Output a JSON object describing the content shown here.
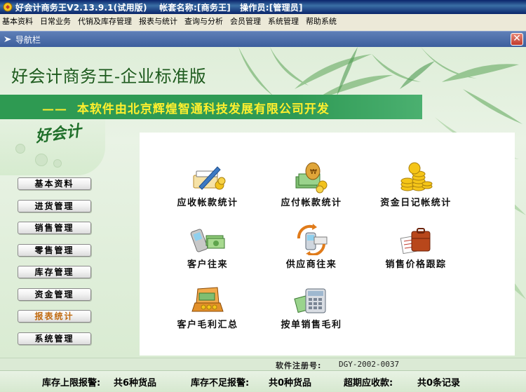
{
  "window": {
    "title": "好会计商务王V2.13.9.1(试用版)    帐套名称:[商务王]   操作员:[管理员]"
  },
  "menu": [
    "基本资料",
    "日常业务",
    "代销及库存管理",
    "报表与统计",
    "查询与分析",
    "会员管理",
    "系统管理",
    "帮助系统"
  ],
  "nav_panel": {
    "title": "导航栏",
    "close_symbol": "✕"
  },
  "banner": {
    "product_name": "好会计商务王-企业标准版",
    "tagline": "——  本软件由北京辉煌智通科技发展有限公司开发",
    "logo": "好会计"
  },
  "sidebar": {
    "items": [
      {
        "label": "基本资料"
      },
      {
        "label": "进货管理"
      },
      {
        "label": "销售管理"
      },
      {
        "label": "零售管理"
      },
      {
        "label": "库存管理"
      },
      {
        "label": "资金管理"
      },
      {
        "label": "报表统计"
      },
      {
        "label": "系统管理"
      }
    ],
    "active_index": 6
  },
  "modules": [
    {
      "label": "应收帐款统计",
      "icon": "receivable-icon"
    },
    {
      "label": "应付帐款统计",
      "icon": "payable-icon"
    },
    {
      "label": "资金日记帐统计",
      "icon": "coins-icon"
    },
    {
      "label": "客户往来",
      "icon": "customer-icon"
    },
    {
      "label": "供应商往来",
      "icon": "supplier-icon"
    },
    {
      "label": "销售价格跟踪",
      "icon": "briefcase-icon"
    },
    {
      "label": "客户毛利汇总",
      "icon": "cashbox-icon"
    },
    {
      "label": "按单销售毛利",
      "icon": "calculator-icon"
    }
  ],
  "registration": {
    "label": "软件注册号:",
    "value": "DGY-2002-0037"
  },
  "status": {
    "upper_alert_label": "库存上限报警:",
    "upper_alert_value": "共6种货品",
    "lower_alert_label": "库存不足报警:",
    "lower_alert_value": "共0种货品",
    "overdue_label": "超期应收款:",
    "overdue_value": "共0条记录"
  },
  "colors": {
    "accent_green": "#2f9a55",
    "tagline_yellow": "#ffef2e",
    "active_sidebar": "#c06a10",
    "title_blue": "#0a246a"
  }
}
